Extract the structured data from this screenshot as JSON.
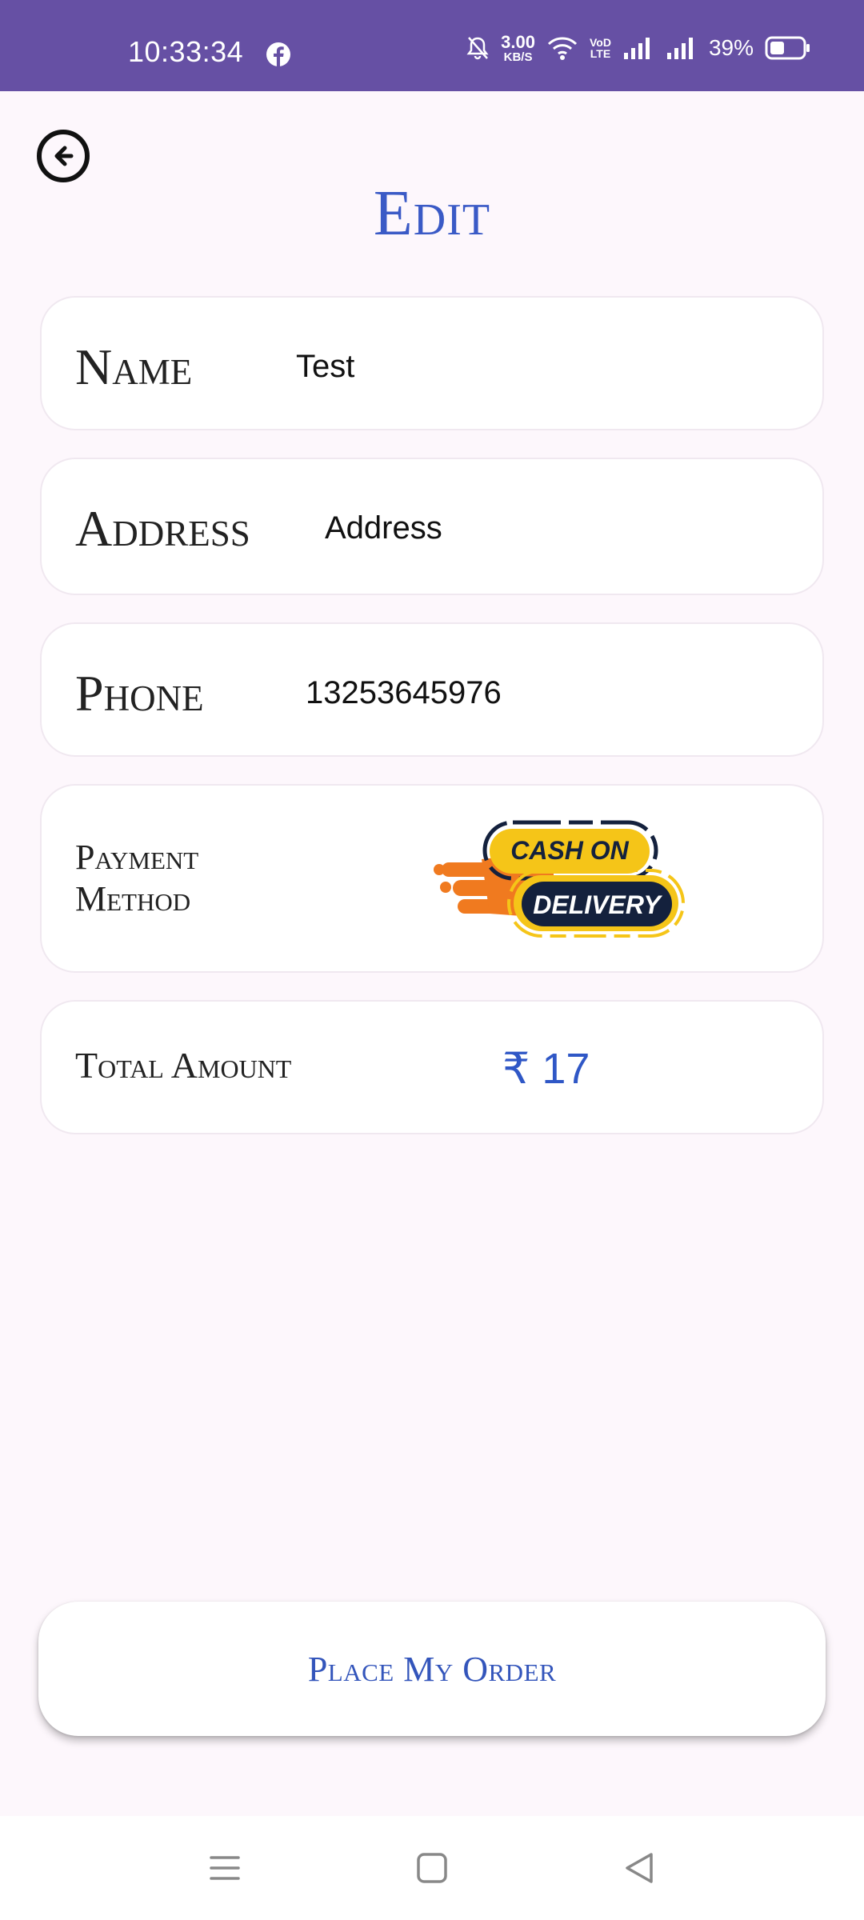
{
  "status_bar": {
    "time": "10:33:34",
    "net_speed_value": "3.00",
    "net_speed_unit": "KB/S",
    "volte_label_top": "VoD",
    "volte_label_bottom": "LTE",
    "battery_percent": "39%",
    "icons": [
      "facebook-icon",
      "mute-icon",
      "wifi-icon",
      "signal-icon",
      "signal-icon",
      "battery-icon"
    ]
  },
  "header": {
    "title": "Edit",
    "back_icon": "arrow-left-circle-icon"
  },
  "form": {
    "name_label": "Name",
    "name_value": "Test",
    "address_label": "Address",
    "address_value": "Address",
    "phone_label": "Phone",
    "phone_value": "13253645976",
    "payment_label_line1": "Payment",
    "payment_label_line2": "Method",
    "payment_logo_line1": "CASH ON",
    "payment_logo_line2": "DELIVERY",
    "total_label": "Total Amount",
    "total_value": "₹ 17"
  },
  "actions": {
    "place_order_label": "Place My Order"
  },
  "colors": {
    "status_bar": "#6650a4",
    "accent_blue": "#3a5ac6",
    "background": "#fdf7fc",
    "logo_yellow": "#f5c518",
    "logo_orange": "#f07a1f",
    "logo_navy": "#14213d"
  },
  "nav_bar": {
    "icons": [
      "menu-icon",
      "home-square-icon",
      "back-triangle-icon"
    ]
  }
}
